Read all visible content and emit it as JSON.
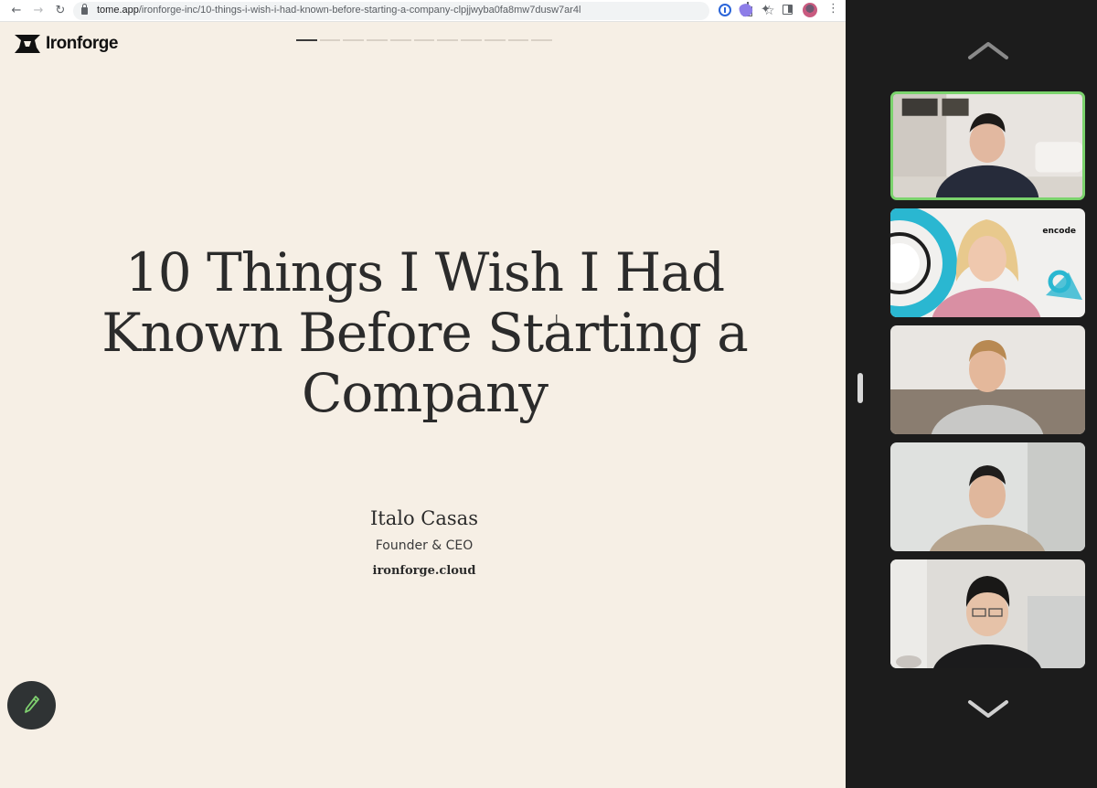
{
  "browser": {
    "url_host": "tome.app",
    "url_path": "/ironforge-inc/10-things-i-wish-i-had-known-before-starting-a-company-clpjjwyba0fa8mw7dusw7ar4l"
  },
  "page": {
    "logo_text": "Ironforge",
    "progress": {
      "total_pages": 11,
      "current_page": 1
    },
    "title": "10 Things I Wish I Had Known Before Starting a Company",
    "author_name": "Italo Casas",
    "author_role": "Founder & CEO",
    "author_site": "ironforge.cloud"
  },
  "call": {
    "participants": [
      {
        "active": true
      },
      {
        "active": false,
        "background_text": "encode"
      },
      {
        "active": false
      },
      {
        "active": false
      },
      {
        "active": false
      }
    ]
  },
  "colors": {
    "page_bg": "#f6efe5",
    "title_text": "#2b2b2b",
    "active_speaker": "#7bd36d",
    "panel_bg": "#1c1c1c"
  }
}
